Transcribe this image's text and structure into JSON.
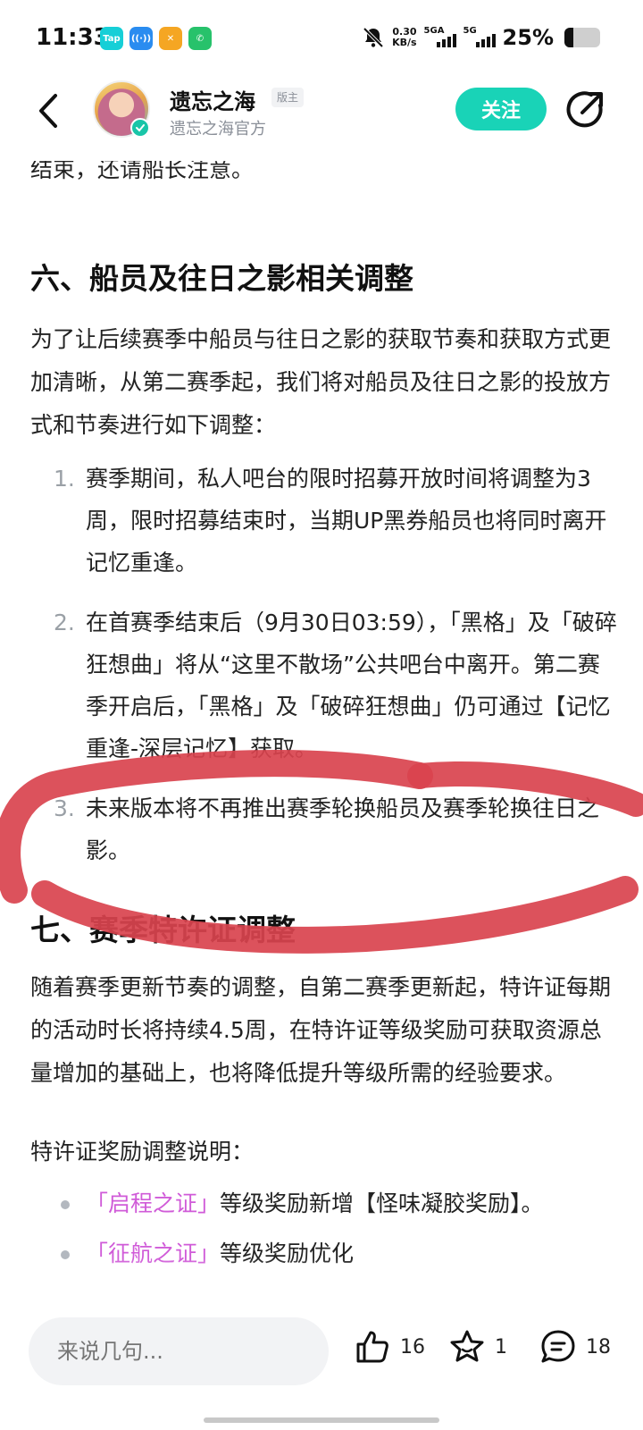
{
  "status_bar": {
    "time": "11:33",
    "app_badges": [
      {
        "icon": "taptap-icon",
        "text": "Tap",
        "color": "#16cfd7"
      },
      {
        "icon": "radio-icon",
        "text": "((·))",
        "color": "#2a8cf0"
      },
      {
        "icon": "app-icon",
        "text": "✕",
        "color": "#f5a623"
      },
      {
        "icon": "phone-icon",
        "text": "✆",
        "color": "#27c26b"
      }
    ],
    "net_speed_value": "0.30",
    "net_speed_unit": "KB/s",
    "signal_1_label": "5GA",
    "signal_2_label": "5G",
    "battery_text": "25%",
    "battery_level": 0.25
  },
  "header": {
    "author_name": "遗忘之海",
    "author_tag": "版主",
    "author_sub": "遗忘之海官方",
    "follow_label": "关注"
  },
  "article": {
    "lead_text": "结束，还请船长注意。",
    "section6_title": "六、船员及往日之影相关调整",
    "section6_intro": "为了让后续赛季中船员与往日之影的获取节奏和获取方式更加清晰，从第二赛季起，我们将对船员及往日之影的投放方式和节奏进行如下调整：",
    "section6_items": [
      {
        "num": "1.",
        "text": "赛季期间，私人吧台的限时招募开放时间将调整为3周，限时招募结束时，当期UP黑券船员也将同时离开记忆重逢。"
      },
      {
        "num": "2.",
        "text": "在首赛季结束后（9月30日03:59），「黑格」及「破碎狂想曲」将从“这里不散场”公共吧台中离开。第二赛季开启后，「黑格」及「破碎狂想曲」仍可通过【记忆重逢-深层记忆】获取。"
      },
      {
        "num": "3.",
        "text": "未来版本将不再推出赛季轮换船员及赛季轮换往日之影。"
      }
    ],
    "section7_title": "七、赛季特许证调整",
    "section7_body": "随着赛季更新节奏的调整，自第二赛季更新起，特许证每期的活动时长将持续4.5周，在特许证等级奖励可获取资源总量增加的基础上，也将降低提升等级所需的经验要求。",
    "pass_label": "特许证奖励调整说明：",
    "pass_items": [
      {
        "highlight": "「启程之证」",
        "text": "等级奖励新增【怪味凝胶奖励】。"
      },
      {
        "highlight": "「征航之证」",
        "text": "等级奖励优化"
      }
    ]
  },
  "bottom_bar": {
    "comment_placeholder": "来说几句...",
    "like_count": "16",
    "favorite_count": "1",
    "comment_count": "18"
  },
  "colors": {
    "accent": "#19d3b7",
    "highlight_pink": "#d05bd8",
    "annotation_red": "#d9434e"
  }
}
